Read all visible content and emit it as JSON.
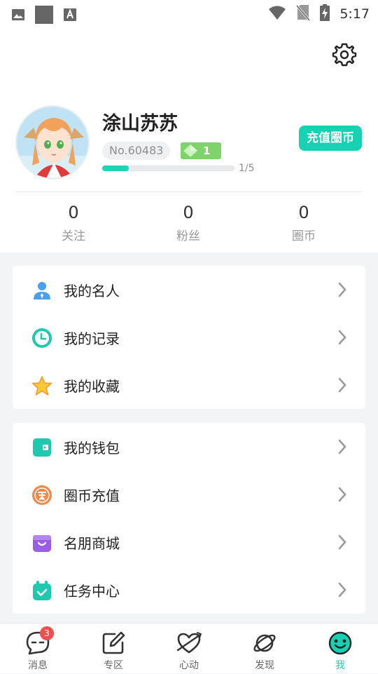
{
  "status_bar": {
    "time": "5:17"
  },
  "profile": {
    "name": "涂山苏苏",
    "uid": "No.60483",
    "level": "1",
    "progress_text": "1/5",
    "progress_fraction": 0.2,
    "recharge_label": "充值圈币"
  },
  "stats": [
    {
      "value": "0",
      "label": "关注"
    },
    {
      "value": "0",
      "label": "粉丝"
    },
    {
      "value": "0",
      "label": "圈币"
    }
  ],
  "menu_group_1": [
    {
      "label": "我的名人",
      "icon": "person-icon"
    },
    {
      "label": "我的记录",
      "icon": "clock-icon"
    },
    {
      "label": "我的收藏",
      "icon": "star-icon"
    }
  ],
  "menu_group_2": [
    {
      "label": "我的钱包",
      "icon": "wallet-icon"
    },
    {
      "label": "圈币充值",
      "icon": "coin-icon"
    },
    {
      "label": "名朋商城",
      "icon": "shop-icon"
    },
    {
      "label": "任务中心",
      "icon": "task-icon"
    }
  ],
  "tabbar": {
    "items": [
      {
        "label": "消息",
        "badge": "3"
      },
      {
        "label": "专区"
      },
      {
        "label": "心动"
      },
      {
        "label": "发现"
      },
      {
        "label": "我"
      }
    ],
    "active_index": 4
  },
  "colors": {
    "accent": "#16d1b2",
    "badge": "#f44d4d",
    "level": "#7ed36a"
  }
}
